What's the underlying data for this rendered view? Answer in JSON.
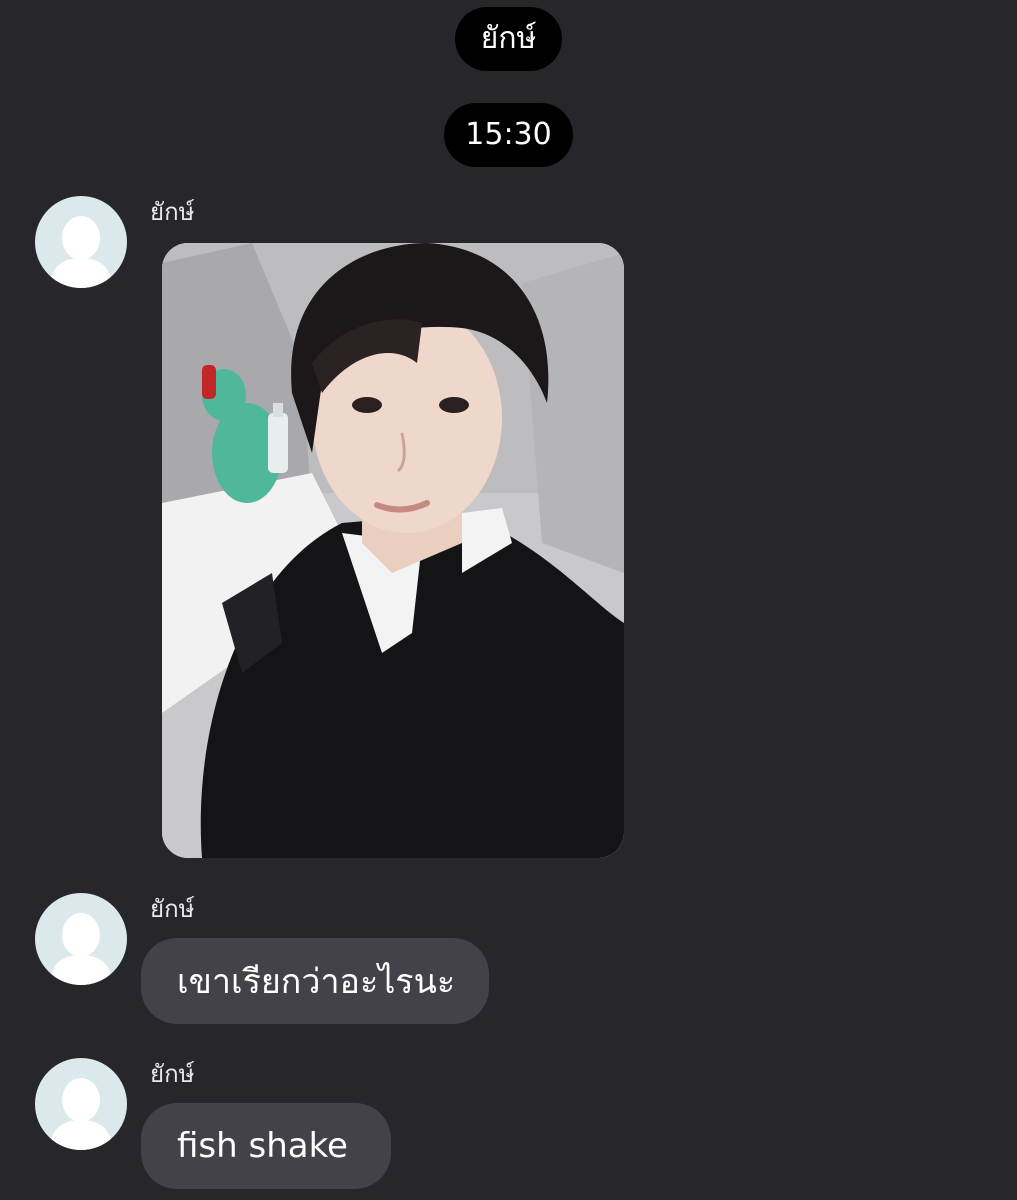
{
  "chat": {
    "header_name": "ยักษ์",
    "timestamp": "15:30",
    "messages": [
      {
        "sender": "ยักษ์",
        "type": "image",
        "image_desc_icon": "photo-selfie"
      },
      {
        "sender": "ยักษ์",
        "type": "text",
        "text": "เขาเรียกว่าอะไรนะ"
      },
      {
        "sender": "ยักษ์",
        "type": "text",
        "text": "fish shake"
      }
    ]
  },
  "colors": {
    "background": "#26262b",
    "pill": "#000000",
    "bubble": "#424248",
    "avatar": "#dbe9ec",
    "avatar_silhouette": "#ffffff"
  }
}
